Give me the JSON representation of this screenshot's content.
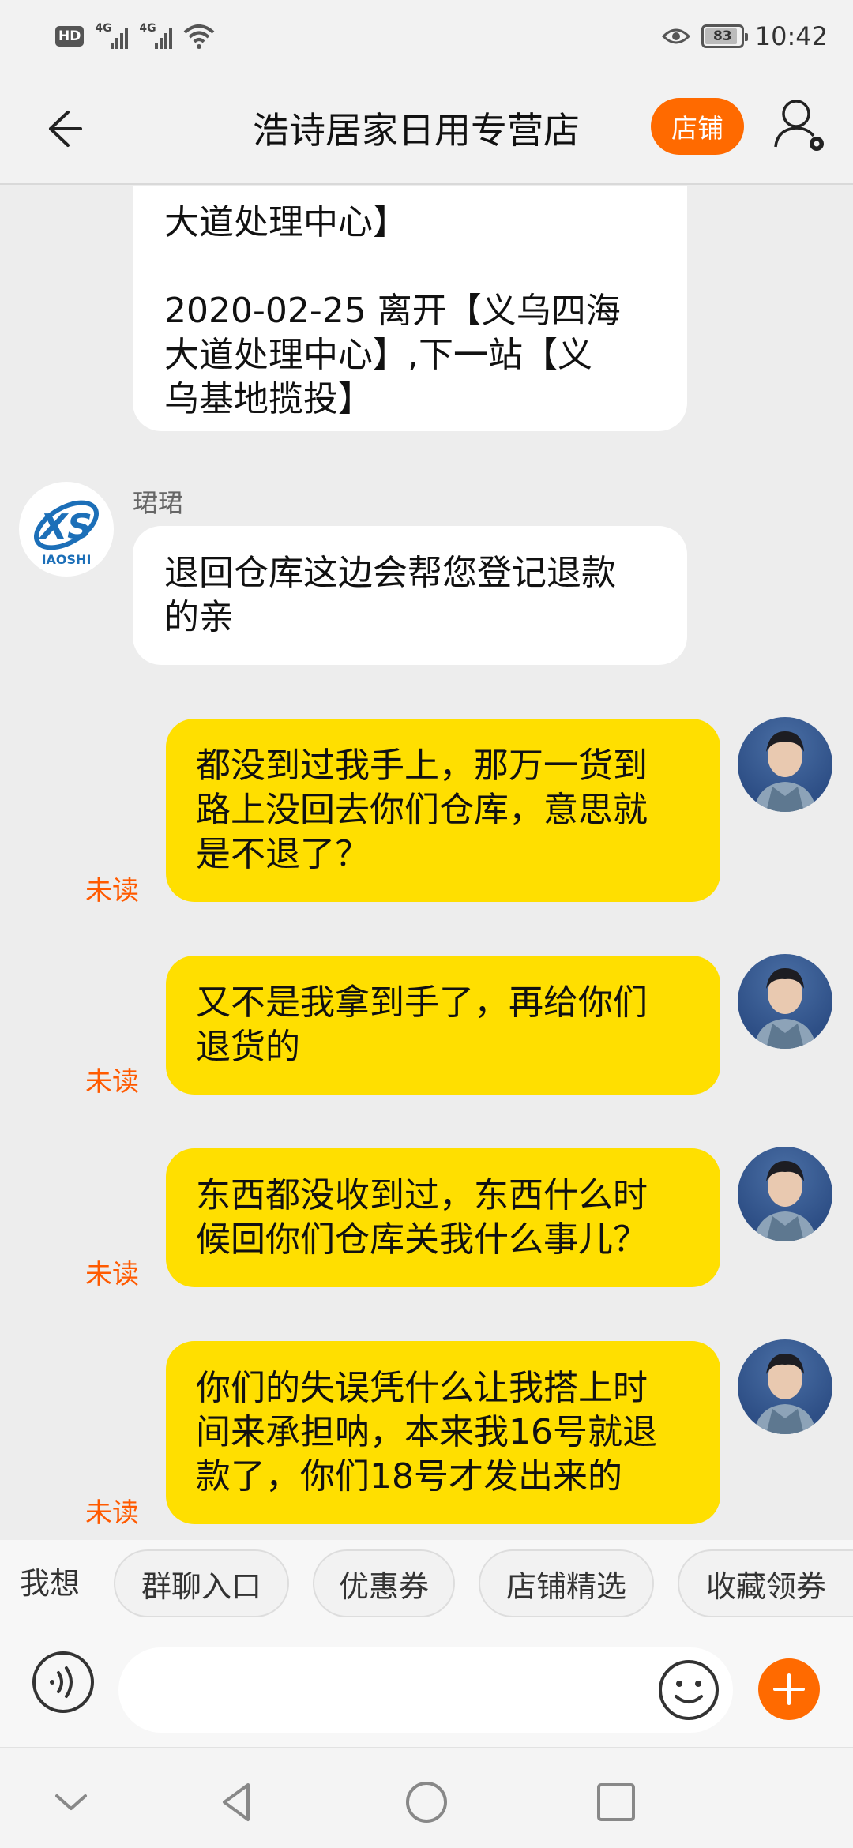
{
  "status_bar": {
    "hd": "HD",
    "signal1": "4G",
    "signal2": "4G",
    "battery": "83",
    "time": "10:42"
  },
  "nav": {
    "title": "浩诗居家日用专营店",
    "shop_label": "店铺"
  },
  "messages": [
    {
      "from": "store",
      "lines": [
        "大道处理中心】",
        "",
        "2020-02-25 离开【义乌四海",
        "大道处理中心】,下一站【义",
        "乌基地揽投】"
      ]
    },
    {
      "from": "store",
      "sender": "珺珺",
      "lines": [
        "退回仓库这边会帮您登记退款",
        "的亲"
      ]
    },
    {
      "from": "me",
      "status": "未读",
      "lines": [
        "都没到过我手上，那万一货到",
        "路上没回去你们仓库，意思就",
        "是不退了？"
      ]
    },
    {
      "from": "me",
      "status": "未读",
      "lines": [
        "又不是我拿到手了，再给你们",
        "退货的"
      ]
    },
    {
      "from": "me",
      "status": "未读",
      "lines": [
        "东西都没收到过，东西什么时",
        "候回你们仓库关我什么事儿？"
      ]
    },
    {
      "from": "me",
      "status": "未读",
      "lines": [
        "你们的失误凭什么让我搭上时",
        "间来承担呐，本来我16号就退",
        "款了，你们18号才发出来的"
      ]
    }
  ],
  "store_logo_text": "XS",
  "store_logo_sub": "IAOSHI",
  "quick": {
    "label": "我想",
    "chips": [
      "群聊入口",
      "优惠券",
      "店铺精选",
      "收藏领券"
    ]
  },
  "input": {
    "placeholder": ""
  },
  "colors": {
    "accent": "#ff6a00",
    "my_bubble": "#ffdf00",
    "unread": "#ff5a00"
  }
}
